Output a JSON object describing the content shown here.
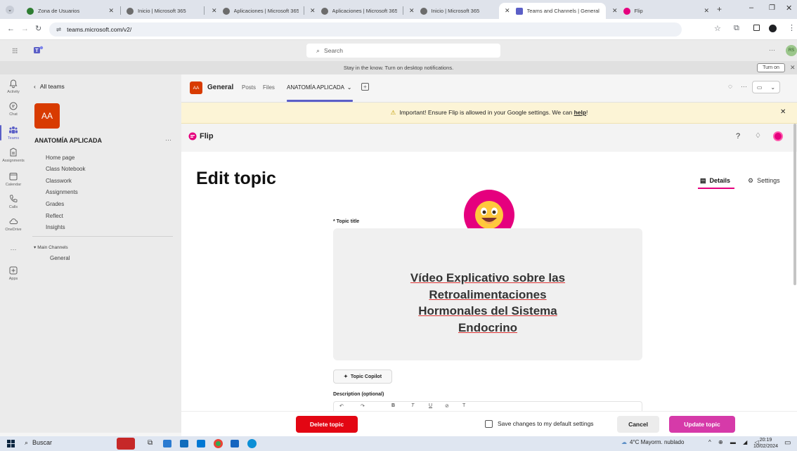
{
  "browser": {
    "tabs": [
      {
        "label": "Zona de Usuarios",
        "color": "#2e7d32"
      },
      {
        "label": "Inicio | Microsoft 365",
        "color": "#555555"
      },
      {
        "label": "Aplicaciones | Microsoft 365",
        "color": "#555555"
      },
      {
        "label": "Aplicaciones | Microsoft 365",
        "color": "#555555"
      },
      {
        "label": "Inicio | Microsoft 365",
        "color": "#555555"
      },
      {
        "label": "Teams and Channels | General",
        "color": "#5b5fc7"
      },
      {
        "label": "Flip",
        "color": "#e5007e"
      }
    ],
    "url": "teams.microsoft.com/v2/"
  },
  "teams": {
    "search_placeholder": "Search",
    "notification": "Stay in the know. Turn on desktop notifications.",
    "turn_on": "Turn on",
    "rail": [
      {
        "label": "Activity",
        "icon": "bell-icon"
      },
      {
        "label": "Chat",
        "icon": "chat-icon"
      },
      {
        "label": "Teams",
        "icon": "teams-icon"
      },
      {
        "label": "Assignments",
        "icon": "assignments-icon"
      },
      {
        "label": "Calendar",
        "icon": "calendar-icon"
      },
      {
        "label": "Calls",
        "icon": "phone-icon"
      },
      {
        "label": "OneDrive",
        "icon": "cloud-icon"
      },
      {
        "label": "Apps",
        "icon": "apps-icon"
      }
    ],
    "team_pane": {
      "back": "All teams",
      "avatar": "AA",
      "team_name": "ANATOMÍA APLICADA",
      "items": [
        "Home page",
        "Class Notebook",
        "Classwork",
        "Assignments",
        "Grades",
        "Reflect",
        "Insights"
      ],
      "section": "Main Channels",
      "channel": "General"
    },
    "channel_header": {
      "avatar": "AA",
      "name": "General",
      "tabs": [
        "Posts",
        "Files"
      ],
      "active_tab": "ANATOMÍA APLICADA"
    },
    "banner": {
      "text": "Important! Ensure Flip is allowed in your Google settings. We can ",
      "link": "help",
      "end": "!"
    }
  },
  "flip": {
    "brand": "Flip",
    "page_title": "Edit topic",
    "tabs": {
      "details": "Details",
      "settings": "Settings"
    },
    "topic_title_label": "* Topic title",
    "topic_title_value": "Vídeo Explicativo sobre las Retroalimentaciones Hormonales del Sistema Endocrino",
    "title_lines": [
      "Vídeo Explicativo sobre las",
      "Retroalimentaciones",
      "Hormonales del Sistema",
      "Endocrino"
    ],
    "copilot": "Topic Copilot",
    "description_label": "Description (optional)",
    "delete": "Delete topic",
    "save_default": "Save changes to my default settings",
    "cancel": "Cancel",
    "update": "Update topic"
  },
  "taskbar": {
    "search": "Buscar",
    "weather": "4°C  Mayorm. nublado",
    "time": "20:19",
    "date": "10/02/2024"
  },
  "colors": {
    "teams_purple": "#5b5fc7",
    "flip_pink": "#e5007e",
    "delete_red": "#e30613",
    "update_pink": "#d63aa9",
    "avatar_orange": "#d83b01"
  }
}
